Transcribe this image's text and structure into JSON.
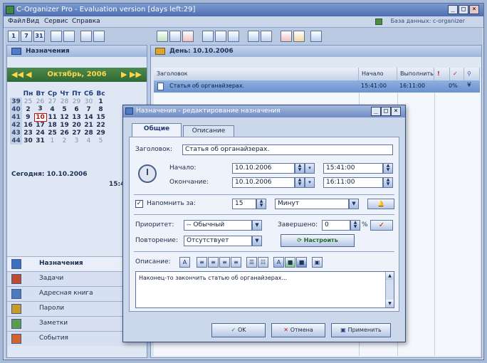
{
  "window": {
    "title": "C-Organizer Pro - Evaluation version [days left:29]"
  },
  "menu": [
    "Файл",
    "Вид",
    "Сервис",
    "Справка"
  ],
  "database_label": "База данных: c-organizer",
  "left_toolbar": [
    "1",
    "7",
    "31",
    "",
    "",
    "",
    ""
  ],
  "right_toolbar_count": 11,
  "left_panel": {
    "title": "Назначения",
    "calendar": {
      "month_label": "Октябрь, 2006",
      "weekdays": [
        "Пн",
        "Вт",
        "Ср",
        "Чт",
        "Пт",
        "Сб",
        "Вс"
      ],
      "weeks": [
        {
          "num": "39",
          "days": [
            "25",
            "26",
            "27",
            "28",
            "29",
            "30",
            "1"
          ]
        },
        {
          "num": "40",
          "days": [
            "2",
            "3",
            "4",
            "5",
            "6",
            "7",
            "8"
          ]
        },
        {
          "num": "41",
          "days": [
            "9",
            "10",
            "11",
            "12",
            "13",
            "14",
            "15"
          ]
        },
        {
          "num": "42",
          "days": [
            "16",
            "17",
            "18",
            "19",
            "20",
            "21",
            "22"
          ]
        },
        {
          "num": "43",
          "days": [
            "23",
            "24",
            "25",
            "26",
            "27",
            "28",
            "29"
          ]
        },
        {
          "num": "44",
          "days": [
            "30",
            "31",
            "1",
            "2",
            "3",
            "4",
            "5"
          ]
        }
      ],
      "today_label": "Сегодня: 10.10.2006",
      "clock": "15:4"
    },
    "nav": [
      {
        "label": "Назначения",
        "icon": "appointments-icon",
        "color": "#3d6fbf"
      },
      {
        "label": "Задачи",
        "icon": "tasks-icon",
        "color": "#c04a2f"
      },
      {
        "label": "Адресная книга",
        "icon": "address-book-icon",
        "color": "#4b7bbd"
      },
      {
        "label": "Пароли",
        "icon": "passwords-icon",
        "color": "#c99a25"
      },
      {
        "label": "Заметки",
        "icon": "notes-icon",
        "color": "#5b9e4a"
      },
      {
        "label": "События",
        "icon": "events-icon",
        "color": "#d3632c"
      }
    ]
  },
  "right_panel": {
    "day_label": "День:  10.10.2006",
    "columns": {
      "title": "Заголовок",
      "start": "Начало",
      "done": "Выполнить",
      "priority": "!",
      "check": "✓",
      "alarm": "⚲"
    },
    "row": {
      "title": "Статья об органайзерах.",
      "start": "15:41:00",
      "end": "16:11:00",
      "percent": "0%"
    }
  },
  "dialog": {
    "title": "Назначения - редактирование назначения",
    "tabs": [
      "Общие",
      "Описание"
    ],
    "subject_label": "Заголовок:",
    "subject_value": "Статья об органайзерах.",
    "start_label": "Начало:",
    "start_date": "10.10.2006",
    "start_time": "15:41:00",
    "end_label": "Окончание:",
    "end_date": "10.10.2006",
    "end_time": "16:11:00",
    "remind_label": "Напомнить за:",
    "remind_value": "15",
    "remind_unit": "Минут",
    "priority_label": "Приоритет:",
    "priority_value": "-- Обычный",
    "complete_label": "Завершено:",
    "complete_value": "0",
    "percent_sign": "%",
    "repeat_label": "Повторение:",
    "repeat_value": "Отсутствует",
    "configure_label": "Настроить",
    "description_label": "Описание:",
    "description_text": "Наконец-то закончить статью об органайзерах...",
    "ok_label": "OK",
    "cancel_label": "Отмена",
    "apply_label": "Применить"
  }
}
